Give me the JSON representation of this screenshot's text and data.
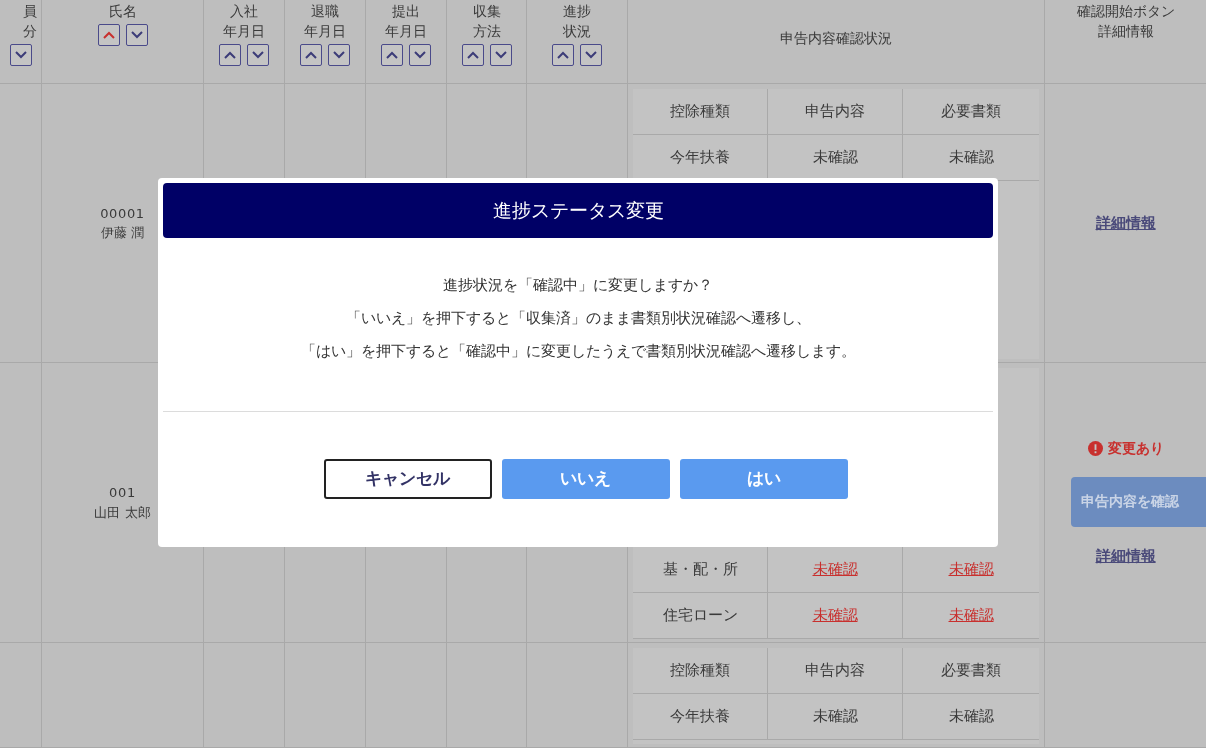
{
  "table": {
    "columns": [
      {
        "label_lines": [
          "員",
          "分"
        ],
        "sort_buttons": [
          {
            "kind": "down",
            "selected": false
          }
        ]
      },
      {
        "label_lines": [
          "氏名"
        ],
        "sort_buttons": [
          {
            "kind": "up",
            "selected": true
          },
          {
            "kind": "down",
            "selected": false
          }
        ]
      },
      {
        "label_lines": [
          "入社",
          "年月日"
        ],
        "sort_buttons": [
          {
            "kind": "up",
            "selected": false
          },
          {
            "kind": "down",
            "selected": false
          }
        ]
      },
      {
        "label_lines": [
          "退職",
          "年月日"
        ],
        "sort_buttons": [
          {
            "kind": "up",
            "selected": false
          },
          {
            "kind": "down",
            "selected": false
          }
        ]
      },
      {
        "label_lines": [
          "提出",
          "年月日"
        ],
        "sort_buttons": [
          {
            "kind": "up",
            "selected": false
          },
          {
            "kind": "down",
            "selected": false
          }
        ]
      },
      {
        "label_lines": [
          "収集",
          "方法"
        ],
        "sort_buttons": [
          {
            "kind": "up",
            "selected": false
          },
          {
            "kind": "down",
            "selected": false
          }
        ]
      },
      {
        "label_lines": [
          "進捗",
          "状況"
        ],
        "sort_buttons": [
          {
            "kind": "up",
            "selected": false
          },
          {
            "kind": "down",
            "selected": false
          }
        ]
      },
      {
        "label_lines": [
          "申告内容確認状況"
        ]
      },
      {
        "label_lines": [
          "確認開始ボタン",
          "詳細情報"
        ]
      }
    ],
    "rows": [
      {
        "employee_code": "00001",
        "employee_name": "伊藤 潤",
        "deductions": {
          "header": [
            "控除種類",
            "申告内容",
            "必要書類"
          ],
          "items": [
            {
              "type": "今年扶養",
              "declaration": "未確認",
              "documents": "未確認",
              "alert": false
            }
          ]
        },
        "actions": [
          {
            "kind": "link",
            "text": "詳細情報"
          }
        ]
      },
      {
        "employee_code": "001",
        "employee_name": "山田 太郎",
        "deductions": {
          "items": [
            {
              "type": "基・配・所",
              "declaration": "未確認",
              "documents": "未確認",
              "alert": true
            },
            {
              "type": "住宅ローン",
              "declaration": "未確認",
              "documents": "未確認",
              "alert": true
            }
          ]
        },
        "actions": [
          {
            "kind": "alert",
            "text": "変更あり"
          },
          {
            "kind": "button",
            "text": "申告内容を確認"
          },
          {
            "kind": "link",
            "text": "詳細情報"
          }
        ]
      },
      {
        "deductions": {
          "header": [
            "控除種類",
            "申告内容",
            "必要書類"
          ],
          "items": [
            {
              "type": "今年扶養",
              "declaration": "未確認",
              "documents": "未確認",
              "alert": false
            }
          ]
        },
        "actions": []
      }
    ]
  },
  "dialog": {
    "title": "進捗ステータス変更",
    "message_lines": [
      "進捗状況を「確認中」に変更しますか？",
      "「いいえ」を押下すると「収集済」のまま書類別状況確認へ遷移し、",
      "「はい」を押下すると「確認中」に変更したうえで書類別状況確認へ遷移します。"
    ],
    "buttons": [
      {
        "kind": "outline",
        "label": "キャンセル"
      },
      {
        "kind": "primary",
        "label": "いいえ"
      },
      {
        "kind": "primary",
        "label": "はい"
      }
    ]
  }
}
